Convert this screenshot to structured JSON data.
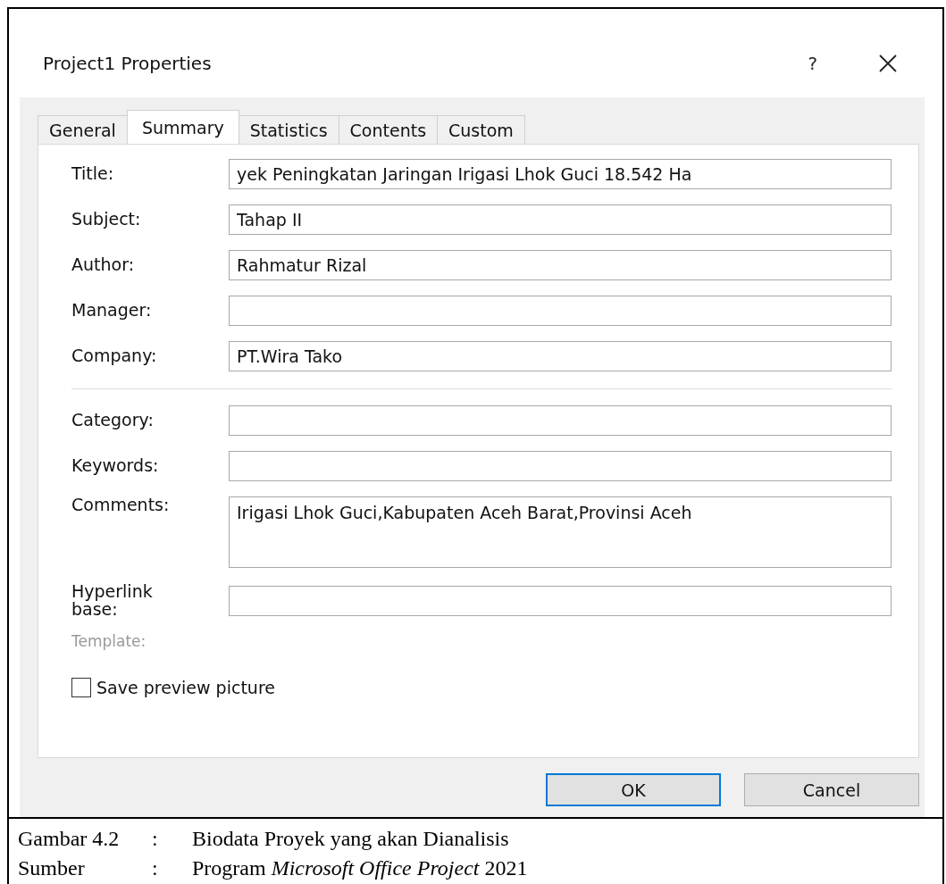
{
  "dialog": {
    "title": "Project1 Properties",
    "help": "?",
    "tabs": [
      {
        "label": "General",
        "selected": false
      },
      {
        "label": "Summary",
        "selected": true
      },
      {
        "label": "Statistics",
        "selected": false
      },
      {
        "label": "Contents",
        "selected": false
      },
      {
        "label": "Custom",
        "selected": false
      }
    ],
    "fields_top": [
      {
        "label": "Title:",
        "value": "yek Peningkatan Jaringan Irigasi Lhok Guci 18.542 Ha",
        "kind": "line"
      },
      {
        "label": "Subject:",
        "value": "Tahap II",
        "kind": "line"
      },
      {
        "label": "Author:",
        "value": "Rahmatur Rizal",
        "kind": "line"
      },
      {
        "label": "Manager:",
        "kind": "line"
      },
      {
        "label": "Company:",
        "value": "PT.Wira Tako",
        "kind": "line"
      }
    ],
    "fields_bottom": [
      {
        "label": "Category:",
        "kind": "line"
      },
      {
        "label": "Keywords:",
        "kind": "line"
      },
      {
        "label": "Comments:",
        "value": "Irigasi Lhok Guci,Kabupaten Aceh Barat,Provinsi Aceh",
        "kind": "multiline"
      },
      {
        "label": "Hyperlink base:",
        "kind": "line"
      }
    ],
    "template": {
      "label": "Template:",
      "disabled": true
    },
    "checkbox": {
      "label": "Save preview picture",
      "checked": false
    },
    "buttons": [
      {
        "label": "OK",
        "default": true
      },
      {
        "label": "Cancel",
        "default": false
      }
    ]
  },
  "caption": [
    {
      "term": "Gambar 4.2",
      "separator": ":",
      "text": "Biodata Proyek yang akan Dianalisis"
    },
    {
      "term": "Sumber",
      "separator": ":",
      "text": "Program *Microsoft Office Project* 2021"
    }
  ]
}
